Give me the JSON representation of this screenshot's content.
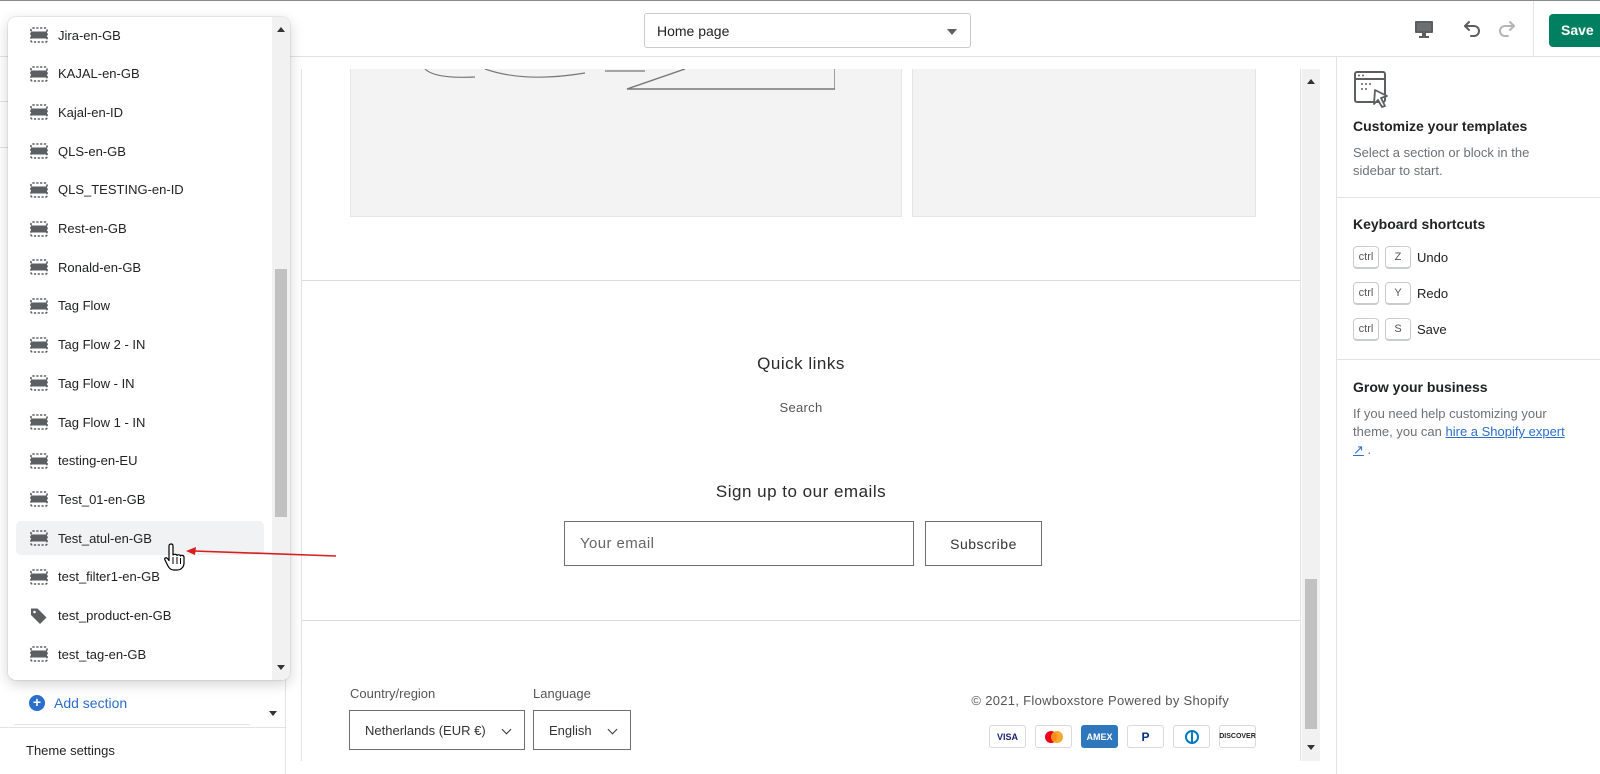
{
  "topbar": {
    "template_select": "Home page",
    "save_label": "Save"
  },
  "popup": {
    "items": [
      {
        "label": "Jira-en-GB",
        "icon": "section-icon"
      },
      {
        "label": "KAJAL-en-GB",
        "icon": "section-icon"
      },
      {
        "label": "Kajal-en-ID",
        "icon": "section-icon"
      },
      {
        "label": "QLS-en-GB",
        "icon": "section-icon"
      },
      {
        "label": "QLS_TESTING-en-ID",
        "icon": "section-icon"
      },
      {
        "label": "Rest-en-GB",
        "icon": "section-icon"
      },
      {
        "label": "Ronald-en-GB",
        "icon": "section-icon"
      },
      {
        "label": "Tag Flow",
        "icon": "section-icon"
      },
      {
        "label": "Tag Flow 2 - IN",
        "icon": "section-icon"
      },
      {
        "label": "Tag Flow - IN",
        "icon": "section-icon"
      },
      {
        "label": "Tag Flow 1 - IN",
        "icon": "section-icon"
      },
      {
        "label": "testing-en-EU",
        "icon": "section-icon"
      },
      {
        "label": "Test_01-en-GB",
        "icon": "section-icon"
      },
      {
        "label": "Test_atul-en-GB",
        "icon": "section-icon",
        "hovered": true
      },
      {
        "label": "test_filter1-en-GB",
        "icon": "section-icon"
      },
      {
        "label": "test_product-en-GB",
        "icon": "tag-icon"
      },
      {
        "label": "test_tag-en-GB",
        "icon": "section-icon"
      }
    ]
  },
  "sidebar": {
    "add_section": "Add section",
    "theme_settings": "Theme settings"
  },
  "preview": {
    "quick_links_heading": "Quick links",
    "quick_links_search": "Search",
    "signup_heading": "Sign up to our emails",
    "email_placeholder": "Your email",
    "subscribe_label": "Subscribe",
    "country_label": "Country/region",
    "country_value": "Netherlands (EUR €)",
    "language_label": "Language",
    "language_value": "English",
    "copyright": "© 2021, Flowboxstore Powered by Shopify",
    "payment_methods": [
      "VISA",
      "Mastercard",
      "AMEX",
      "PayPal",
      "Diners",
      "DISCOVER"
    ]
  },
  "right_panel": {
    "customize_title": "Customize your templates",
    "customize_desc": "Select a section or block in the sidebar to start.",
    "shortcuts_title": "Keyboard shortcuts",
    "shortcuts": [
      {
        "mod": "ctrl",
        "key": "Z",
        "label": "Undo"
      },
      {
        "mod": "ctrl",
        "key": "Y",
        "label": "Redo"
      },
      {
        "mod": "ctrl",
        "key": "S",
        "label": "Save"
      }
    ],
    "grow_title": "Grow your business",
    "grow_desc_prefix": "If you need help customizing your theme, you can ",
    "grow_link": "hire a Shopify expert",
    "grow_desc_suffix": " ."
  },
  "colors": {
    "accent_green": "#008060",
    "link_blue": "#2c6ecb",
    "annotation_red": "#d81e1e"
  }
}
